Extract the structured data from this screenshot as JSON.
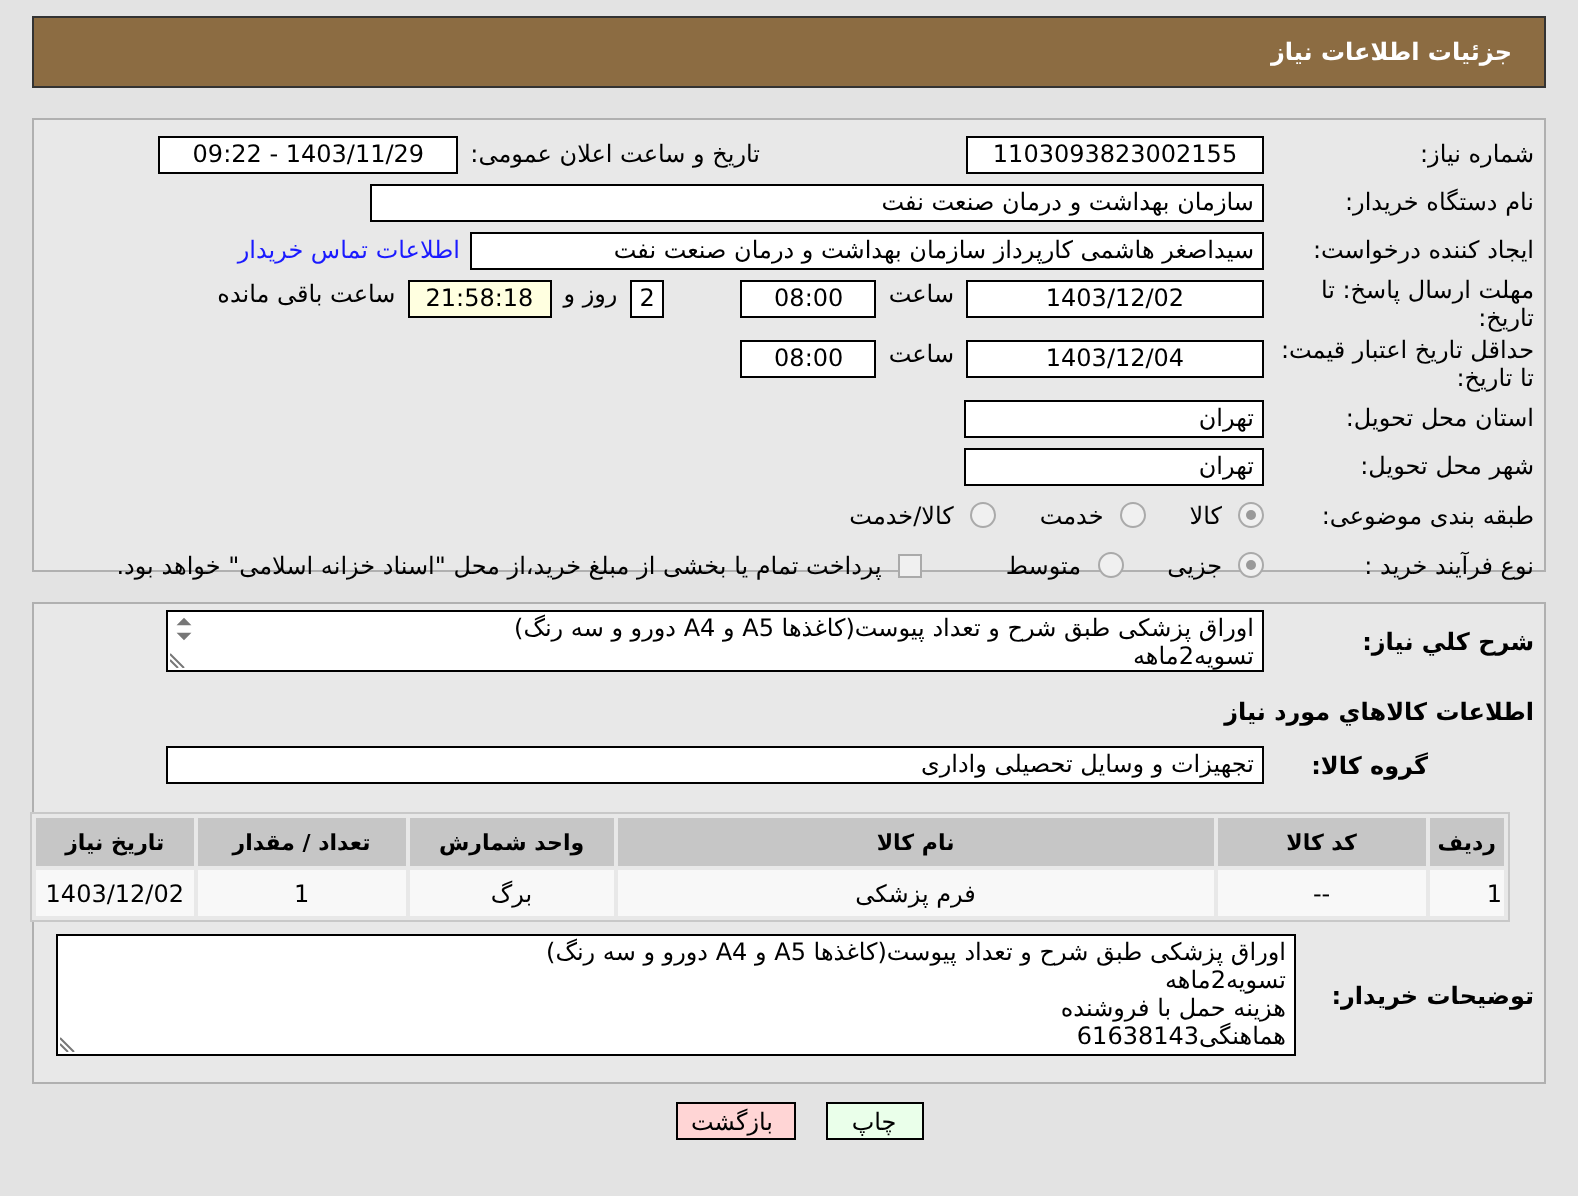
{
  "header": {
    "title": "جزئیات اطلاعات نیاز"
  },
  "need_number": {
    "label": "شماره نیاز:",
    "value": "1103093823002155"
  },
  "announce": {
    "label": "تاریخ و ساعت اعلان عمومی:",
    "value": "1403/11/29 - 09:22"
  },
  "buyer_org": {
    "label": "نام دستگاه خریدار:",
    "value": "سازمان بهداشت و درمان صنعت نفت"
  },
  "requester": {
    "label": "ایجاد کننده درخواست:",
    "value": "سیداصغر هاشمی کارپرداز سازمان بهداشت و درمان صنعت نفت",
    "link": "اطلاعات تماس خریدار"
  },
  "reply_deadline": {
    "label": "مهلت ارسال پاسخ: تا تاریخ:",
    "date": "1403/12/02",
    "time_label": "ساعت",
    "time": "08:00",
    "days": "2",
    "days_label": "روز و",
    "remaining": "21:58:18",
    "remaining_label": "ساعت باقی مانده"
  },
  "price_validity": {
    "label": "حداقل تاریخ اعتبار قیمت: تا تاریخ:",
    "date": "1403/12/04",
    "time_label": "ساعت",
    "time": "08:00"
  },
  "province": {
    "label": "استان محل تحویل:",
    "value": "تهران"
  },
  "city": {
    "label": "شهر محل تحویل:",
    "value": "تهران"
  },
  "category": {
    "label": "طبقه بندی موضوعی:",
    "options": [
      {
        "label": "کالا",
        "selected": true
      },
      {
        "label": "خدمت",
        "selected": false
      },
      {
        "label": "کالا/خدمت",
        "selected": false
      }
    ]
  },
  "process": {
    "label": "نوع فرآیند خرید :",
    "options": [
      {
        "label": "جزیی",
        "selected": true
      },
      {
        "label": "متوسط",
        "selected": false
      }
    ],
    "treasury": {
      "label": "پرداخت تمام یا بخشی از مبلغ خرید،از محل \"اسناد خزانه اسلامی\" خواهد بود.",
      "checked": false
    }
  },
  "description": {
    "label": "شرح کلي نياز:",
    "lines": [
      "اوراق پزشکی طبق شرح و تعداد پیوست(کاغذها A5 و A4 دورو و سه رنگ)",
      "تسویه2ماهه"
    ]
  },
  "goods_heading": "اطلاعات کالاهاي مورد نياز",
  "goods_group": {
    "label": "گروه کالا:",
    "value": "تجهیزات و وسایل تحصیلی واداری"
  },
  "table": {
    "columns": [
      "ردیف",
      "کد کالا",
      "نام کالا",
      "واحد شمارش",
      "تعداد / مقدار",
      "تاریخ نیاز"
    ],
    "rows": [
      [
        "1",
        "--",
        "فرم پزشکی",
        "برگ",
        "1",
        "1403/12/02"
      ]
    ]
  },
  "buyer_notes": {
    "label": "توضیحات خریدار:",
    "lines": [
      "اوراق پزشکی طبق شرح و تعداد پیوست(کاغذها A5 و A4 دورو و سه رنگ)",
      "تسویه2ماهه",
      "هزینه حمل با فروشنده",
      "هماهنگی61638143"
    ]
  },
  "buttons": [
    {
      "label": "چاپ",
      "kind": "print"
    },
    {
      "label": "بازگشت",
      "kind": "back"
    }
  ]
}
